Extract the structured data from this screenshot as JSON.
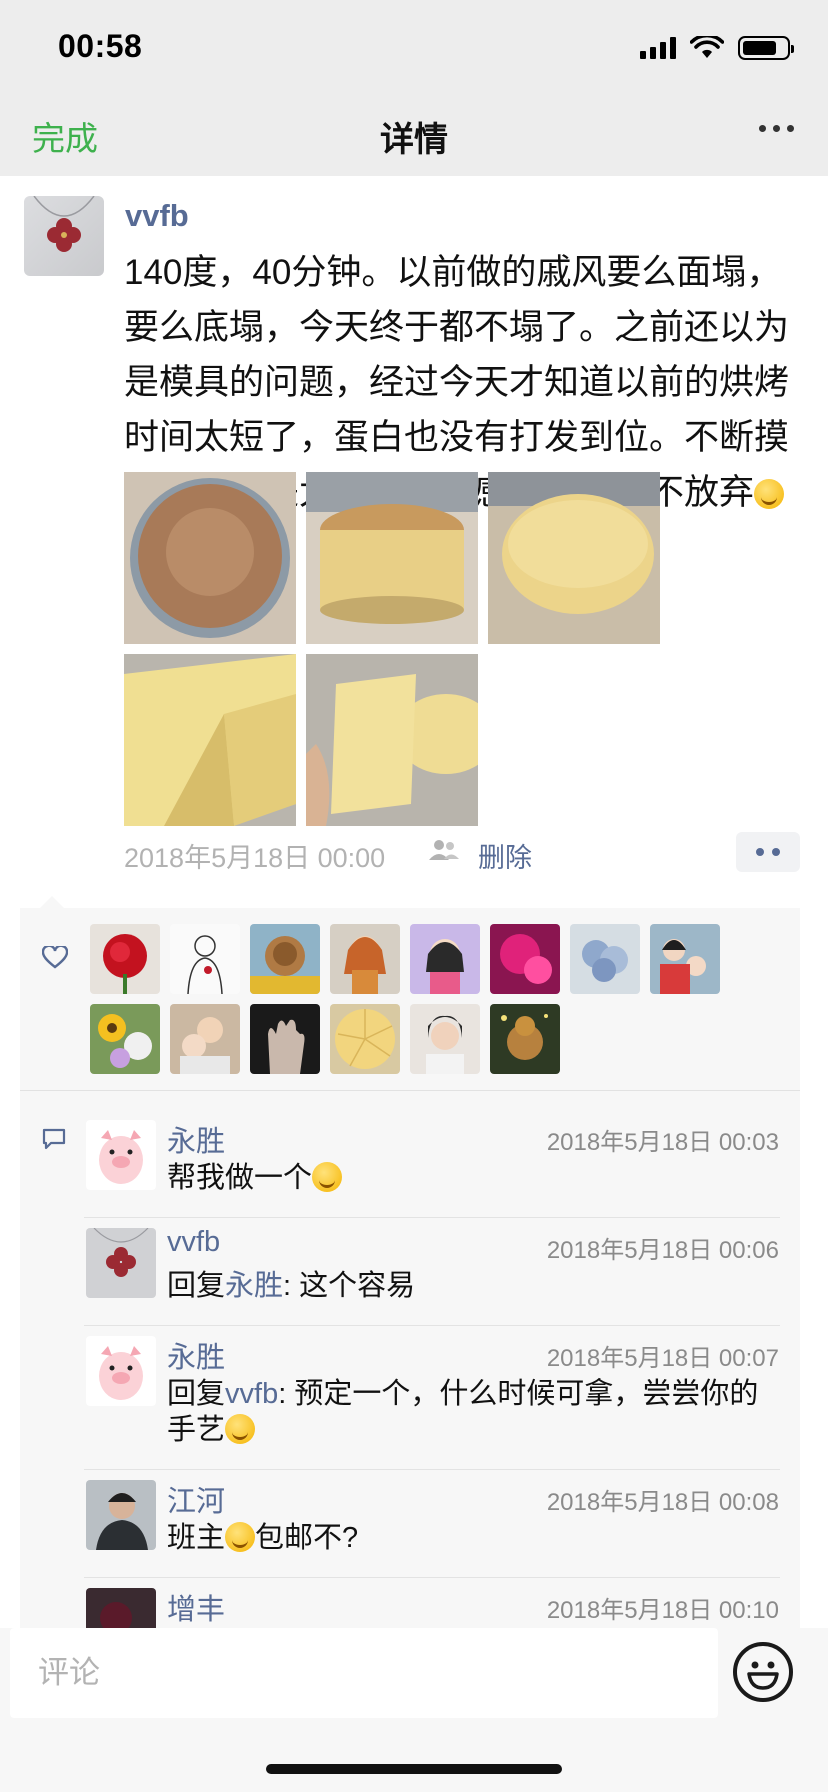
{
  "status": {
    "time": "00:58"
  },
  "nav": {
    "done_label": "完成",
    "title": "详情"
  },
  "post": {
    "author": "vvfb",
    "text": "140度，40分钟。以前做的戚风要么面塌，要么底塌，今天终于都不塌了。之前还以为是模具的问题，经过今天才知道以前的烘烤时间太短了，蛋白也没有打发到位。不断摸索改进真是太重要了，感谢自己的不放弃",
    "time": "2018年5月18日 00:00",
    "delete_label": "删除",
    "photos": [
      "cake-top",
      "cake-side",
      "cake-side-2",
      "cake-cut",
      "cake-slice"
    ]
  },
  "likes": {
    "avatars": [
      "rose",
      "sketch-girl",
      "dog",
      "cartoon-girl",
      "anime-girl",
      "pink-flower",
      "blue-flowers",
      "woman-child",
      "sunflowers",
      "family",
      "hand",
      "cake-slices",
      "woman",
      "cartoon-pig"
    ]
  },
  "comments": [
    {
      "name": "永胜",
      "time": "2018年5月18日 00:03",
      "reply_prefix": "",
      "reply_to": "",
      "text": "帮我做一个",
      "text_after": "",
      "emoji": true,
      "avatar": "pig"
    },
    {
      "name": "vvfb",
      "time": "2018年5月18日 00:06",
      "reply_prefix": "回复",
      "reply_to": "永胜",
      "text": ": 这个容易",
      "text_after": "",
      "emoji": false,
      "avatar": "clover"
    },
    {
      "name": "永胜",
      "time": "2018年5月18日 00:07",
      "reply_prefix": "回复",
      "reply_to": "vvfb",
      "text": ": 预定一个，什么时候可拿，尝尝你的手艺",
      "text_after": "",
      "emoji": true,
      "avatar": "pig"
    },
    {
      "name": "江河",
      "time": "2018年5月18日 00:08",
      "reply_prefix": "",
      "reply_to": "",
      "text": "班主",
      "text_after": "包邮不?",
      "emoji": true,
      "avatar": "man"
    },
    {
      "name": "增丰",
      "time": "2018年5月18日 00:10",
      "reply_prefix": "",
      "reply_to": "",
      "text": "",
      "text_after": "",
      "emoji": false,
      "avatar": "dark"
    }
  ],
  "input": {
    "placeholder": "评论"
  }
}
